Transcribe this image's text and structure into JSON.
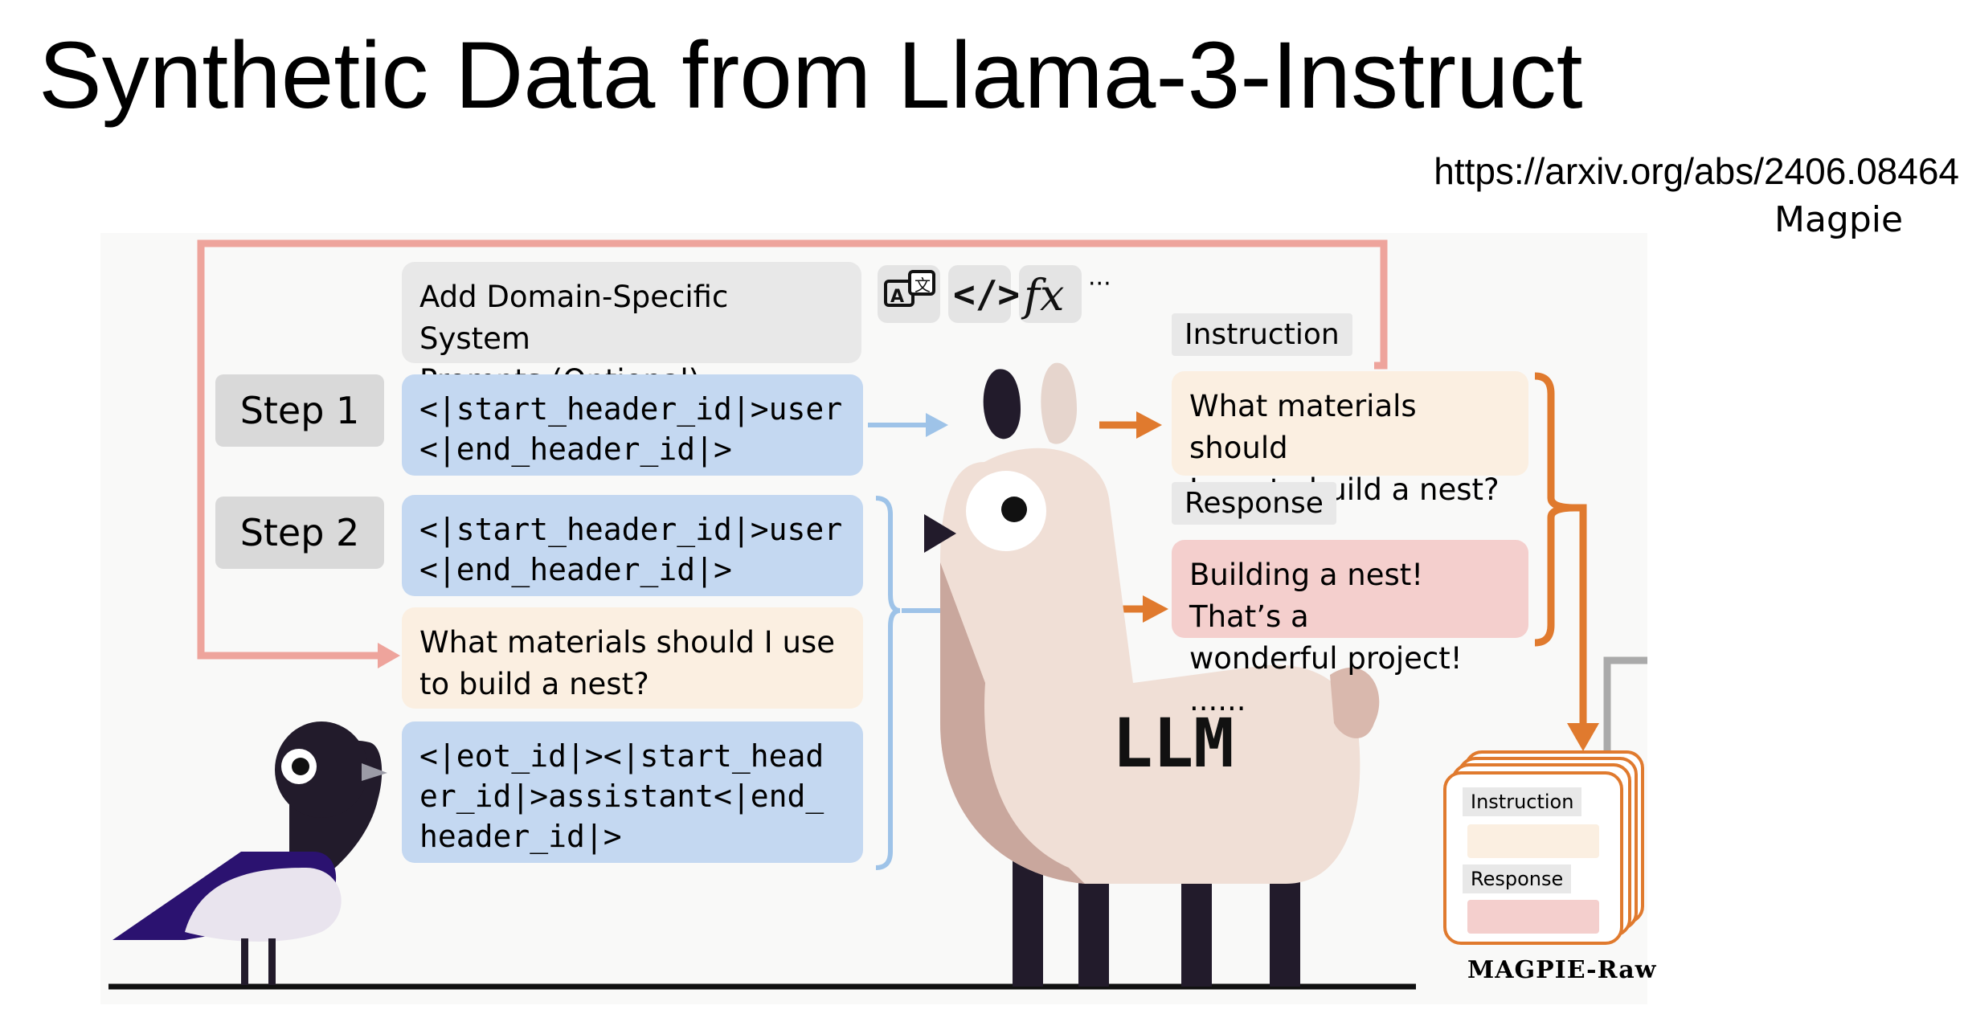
{
  "slide": {
    "title": "Synthetic Data from Llama-3-Instruct",
    "url": "https://arxiv.org/abs/2406.08464",
    "caption": "Magpie"
  },
  "diagram": {
    "system_prompt_line1": "Add Domain-Specific System",
    "system_prompt_line2": "Prompts (Optional)",
    "tool_icons": [
      "translate-icon",
      "code-icon",
      "function-icon"
    ],
    "ellipsis": "···",
    "step1_label": "Step 1",
    "step2_label": "Step 2",
    "step1_template_line1": "<|start_header_id|>user",
    "step1_template_line2": "<|end_header_id|>",
    "step2_template_line1": "<|start_header_id|>user",
    "step2_template_line2": "<|end_header_id|>",
    "step2_question_line1": "What materials should I use",
    "step2_question_line2": "to build a nest?",
    "assistant_line1": "<|eot_id|><|start_head",
    "assistant_line2": "er_id|>assistant<|end_",
    "assistant_line3": "header_id|>",
    "instruction_label": "Instruction",
    "instruction_line1": "What materials should",
    "instruction_line2": "I use to build a nest?",
    "response_label": "Response",
    "response_line1": "Building a nest! That’s a",
    "response_line2": "wonderful project! ......",
    "llm_label": "LLM",
    "dataset_instruction_label": "Instruction",
    "dataset_response_label": "Response",
    "dataset_name": "MAGPIE-Raw",
    "colors": {
      "loop_arrow": "#eea49c",
      "blue_arrow": "#9ec3e8",
      "orange_arrow": "#e07a2e",
      "blue_box": "#c4d8f1",
      "cream_box": "#fbefe1",
      "pink_box": "#f4cfcd"
    }
  }
}
